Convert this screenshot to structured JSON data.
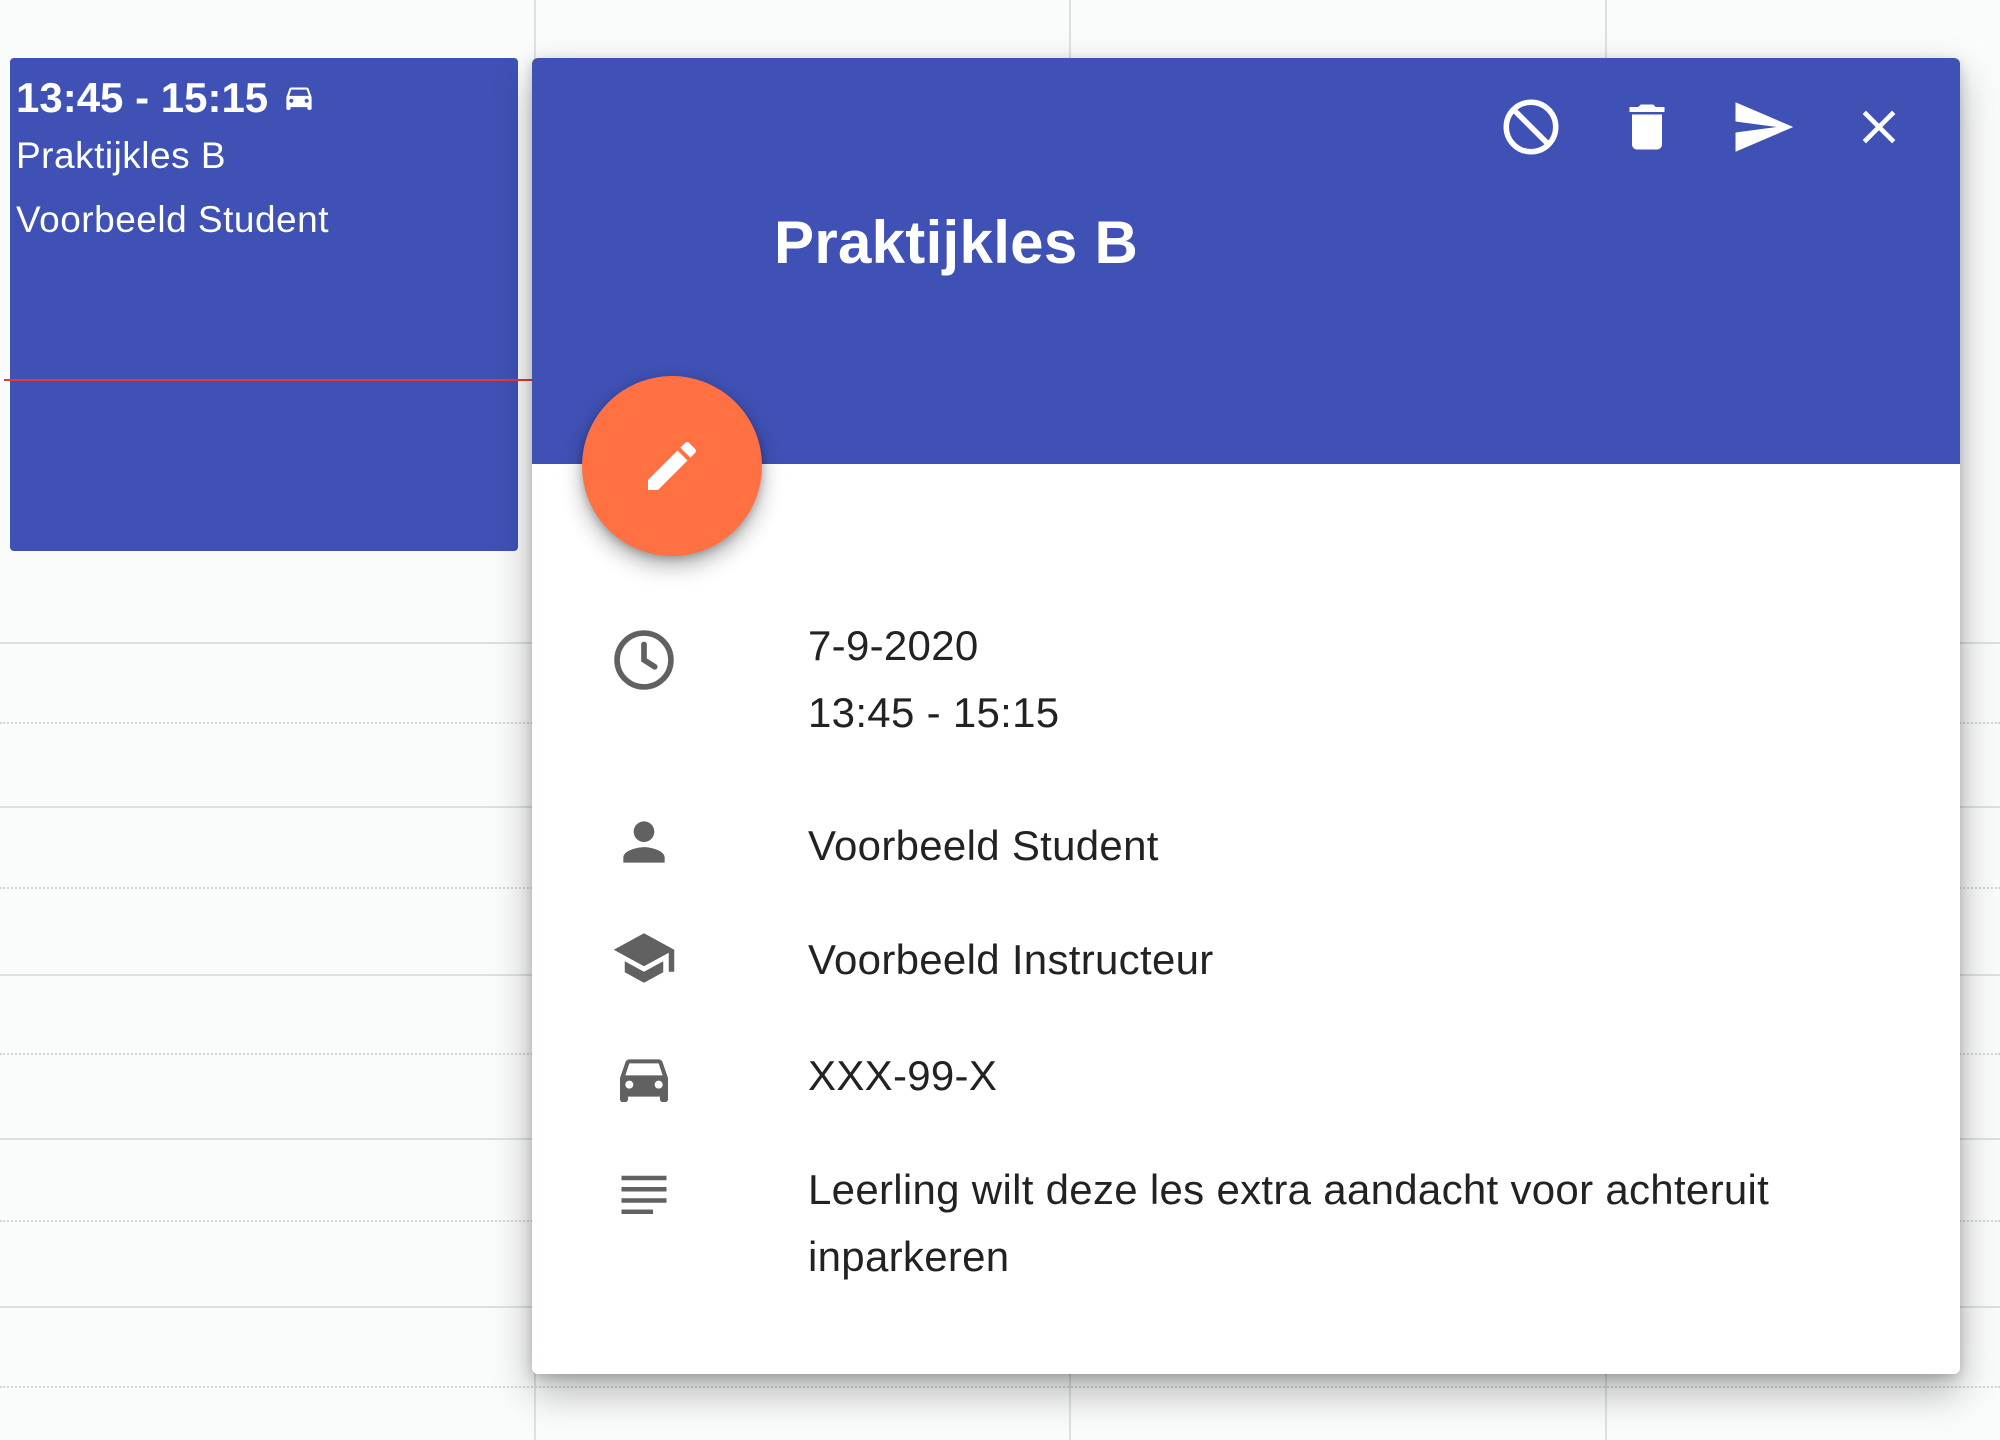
{
  "calendar_event": {
    "time": "13:45 - 15:15",
    "title": "Praktijkles B",
    "student": "Voorbeeld Student"
  },
  "popup": {
    "title": "Praktijkles B",
    "toolbar": {
      "cancel_icon": "block-icon",
      "delete_icon": "trash-icon",
      "send_icon": "send-icon",
      "close_icon": "close-icon"
    },
    "edit_icon": "pencil-icon",
    "details": {
      "date": "7-9-2020",
      "time": "13:45 - 15:15",
      "student": "Voorbeeld Student",
      "instructor": "Voorbeeld Instructeur",
      "vehicle": "XXX-99-X",
      "note": "Leerling wilt deze les extra aandacht voor achteruit inparkeren"
    }
  },
  "colors": {
    "primary": "#3f51b5",
    "accent": "#ff7043",
    "now_line": "#e53935",
    "icon_gray": "#616161"
  }
}
